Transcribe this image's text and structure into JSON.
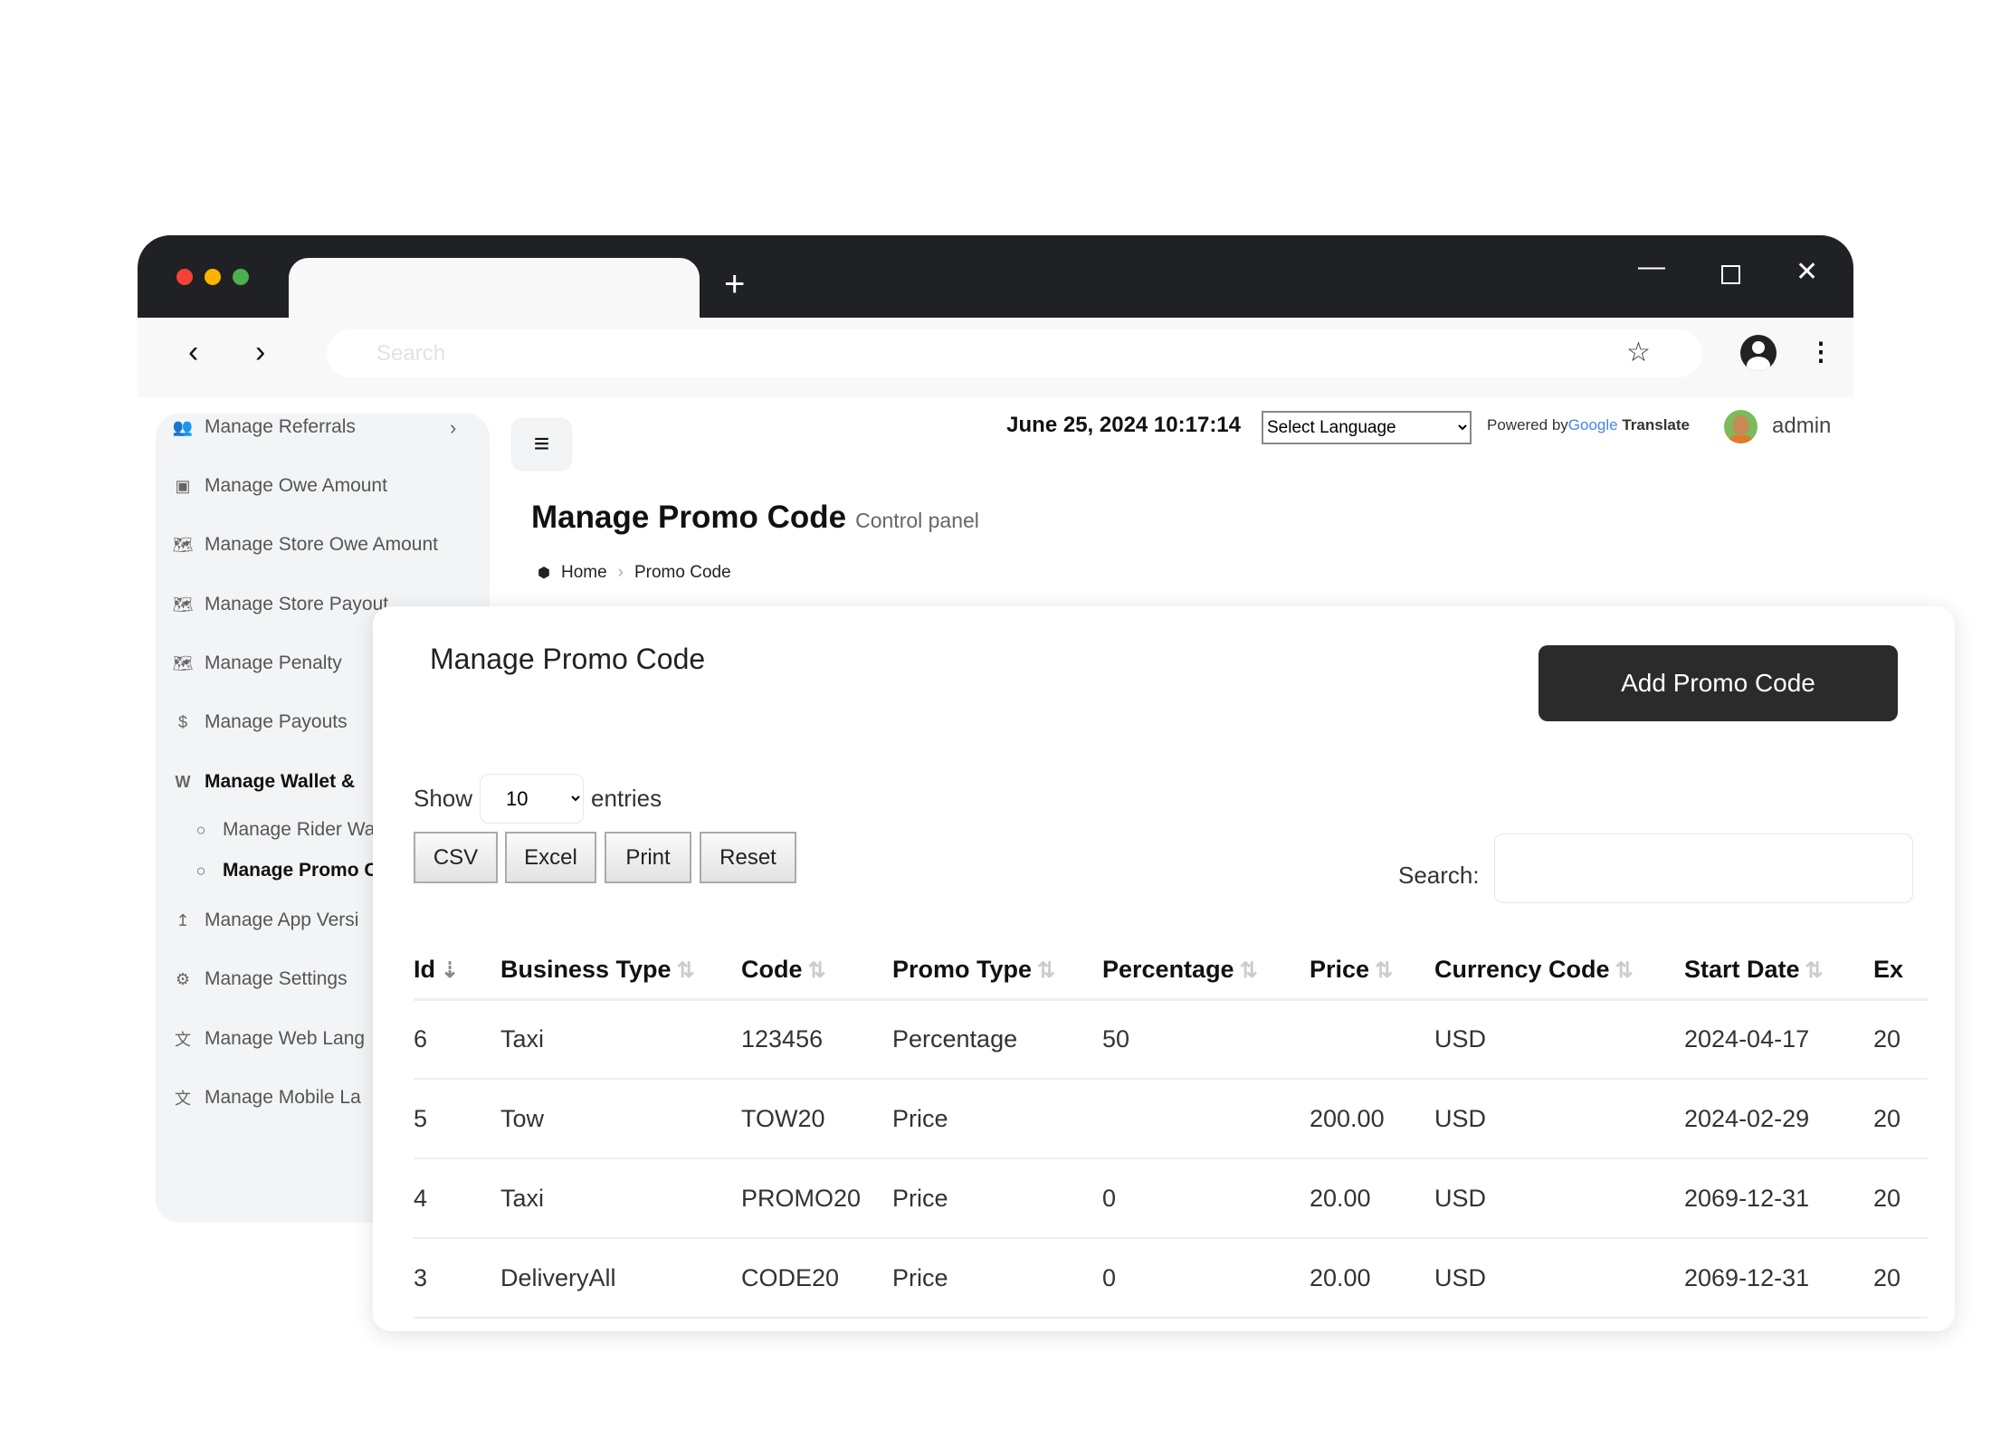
{
  "browser": {
    "address_placeholder": "Search",
    "new_tab": "+",
    "icons": [
      "back-icon",
      "forward-icon",
      "star-icon",
      "profile-icon",
      "more-icon",
      "minimize-icon",
      "maximize-icon",
      "close-icon"
    ]
  },
  "sidebar": {
    "items": [
      {
        "label": "Manage Referrals",
        "icon": "users-icon",
        "glyph": "👥"
      },
      {
        "label": "Manage Owe Amount",
        "icon": "money-icon",
        "glyph": "▣"
      },
      {
        "label": "Manage Store Owe Amount",
        "icon": "map-icon",
        "glyph": "🗺"
      },
      {
        "label": "Manage Store Payout",
        "icon": "map-icon",
        "glyph": "🗺"
      },
      {
        "label": "Manage Penalty",
        "icon": "map-icon",
        "glyph": "🗺"
      },
      {
        "label": "Manage Payouts",
        "icon": "dollar-icon",
        "glyph": "$"
      },
      {
        "label": "Manage Wallet &",
        "icon": "wallet-icon",
        "glyph": "W"
      },
      {
        "label": "Manage Rider Wa",
        "icon": "circle-icon",
        "glyph": "○"
      },
      {
        "label": "Manage Promo C",
        "icon": "circle-icon",
        "glyph": "○"
      },
      {
        "label": "Manage App Versi",
        "icon": "upload-icon",
        "glyph": "↥"
      },
      {
        "label": "Manage Settings",
        "icon": "gear-icon",
        "glyph": "⚙"
      },
      {
        "label": "Manage Web Lang",
        "icon": "language-icon",
        "glyph": "文"
      },
      {
        "label": "Manage Mobile La",
        "icon": "language-icon",
        "glyph": "文"
      }
    ]
  },
  "header": {
    "datetime": "June 25, 2024 10:17:14",
    "language_select": "Select Language",
    "powered_by": "Powered by",
    "google": "Google",
    "translate": "Translate",
    "user": "admin"
  },
  "page": {
    "title": "Manage Promo Code",
    "subtitle": "Control panel",
    "breadcrumb": [
      "Home",
      "Promo Code"
    ]
  },
  "card": {
    "title": "Manage Promo Code",
    "add_button": "Add Promo Code",
    "show": "Show",
    "entries_value": "10",
    "entries": "entries",
    "export_buttons": [
      "CSV",
      "Excel",
      "Print",
      "Reset"
    ],
    "search_label": "Search:"
  },
  "table": {
    "columns": [
      "Id",
      "Business Type",
      "Code",
      "Promo Type",
      "Percentage",
      "Price",
      "Currency Code",
      "Start Date",
      "Ex"
    ],
    "rows": [
      [
        "6",
        "Taxi",
        "123456",
        "Percentage",
        "50",
        "",
        "USD",
        "2024-04-17",
        "20"
      ],
      [
        "5",
        "Tow",
        "TOW20",
        "Price",
        "",
        "200.00",
        "USD",
        "2024-02-29",
        "20"
      ],
      [
        "4",
        "Taxi",
        "PROMO20",
        "Price",
        "0",
        "20.00",
        "USD",
        "2069-12-31",
        "20"
      ],
      [
        "3",
        "DeliveryAll",
        "CODE20",
        "Price",
        "0",
        "20.00",
        "USD",
        "2069-12-31",
        "20"
      ]
    ]
  },
  "colors": {
    "chrome_dark": "#202124",
    "button_dark": "#2b2b2b",
    "sidebar_bg": "#f3f4f6"
  }
}
